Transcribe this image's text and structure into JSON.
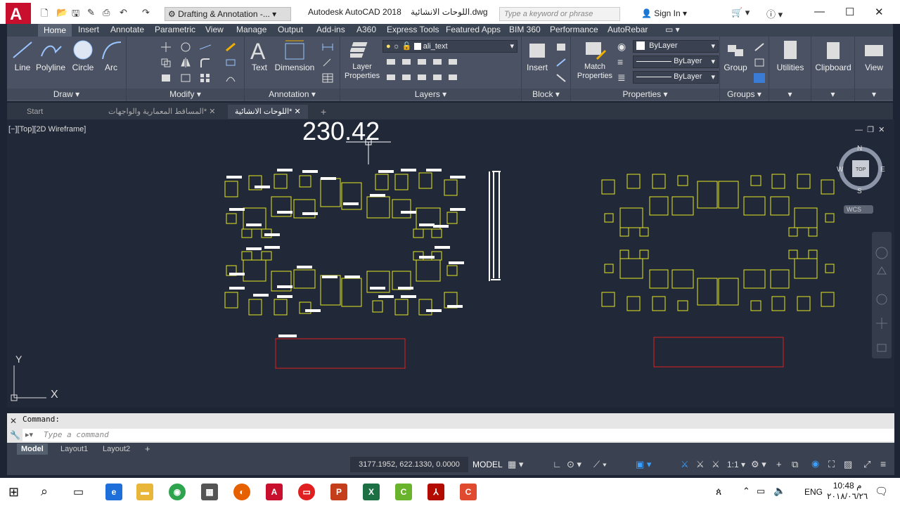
{
  "title_bar": {
    "app_title": "Autodesk AutoCAD 2018",
    "file_title": "اللوحات الانشائية.dwg",
    "workspace": "Drafting & Annotation -...",
    "search_placeholder": "Type a keyword or phrase",
    "sign_in": "Sign In"
  },
  "ribbon_tabs": [
    "Home",
    "Insert",
    "Annotate",
    "Parametric",
    "View",
    "Manage",
    "Output",
    "Add-ins",
    "A360",
    "Express Tools",
    "Featured Apps",
    "BIM 360",
    "Performance",
    "AutoRebar"
  ],
  "ribbon": {
    "draw": {
      "title": "Draw",
      "line": "Line",
      "polyline": "Polyline",
      "circle": "Circle",
      "arc": "Arc"
    },
    "modify": {
      "title": "Modify"
    },
    "annotation": {
      "title": "Annotation",
      "text": "Text",
      "dimension": "Dimension"
    },
    "layers": {
      "title": "Layers",
      "layer_properties_1": "Layer",
      "layer_properties_2": "Properties",
      "current_layer": "ali_text"
    },
    "block": {
      "title": "Block",
      "insert": "Insert"
    },
    "properties": {
      "title": "Properties",
      "match_1": "Match",
      "match_2": "Properties",
      "color": "ByLayer",
      "linetype": "ByLayer",
      "lineweight": "ByLayer"
    },
    "groups": {
      "title": "Groups",
      "group": "Group"
    },
    "utilities": "Utilities",
    "clipboard": "Clipboard",
    "view": "View"
  },
  "doc_tabs": {
    "start": "Start",
    "tab1": "المساقط المعمارية والواجهات*",
    "tab2": "اللوحات الانشائية*"
  },
  "viewport": {
    "label": "[−][Top][2D Wireframe]",
    "dynamic_value": "230.42",
    "compass": {
      "n": "N",
      "s": "S",
      "e": "E",
      "w": "W",
      "top": "TOP",
      "wcs": "WCS"
    },
    "ucs_x": "X",
    "ucs_y": "Y"
  },
  "command": {
    "history": "Command:",
    "placeholder": "Type a command"
  },
  "layout_tabs": [
    "Model",
    "Layout1",
    "Layout2"
  ],
  "status": {
    "coords": "3177.1952, 622.1330, 0.0000",
    "model": "MODEL",
    "scale": "1:1"
  },
  "taskbar": {
    "lang": "ENG",
    "time": "10:48 م",
    "date": "٢٠١٨/٠٦/٢٦"
  }
}
